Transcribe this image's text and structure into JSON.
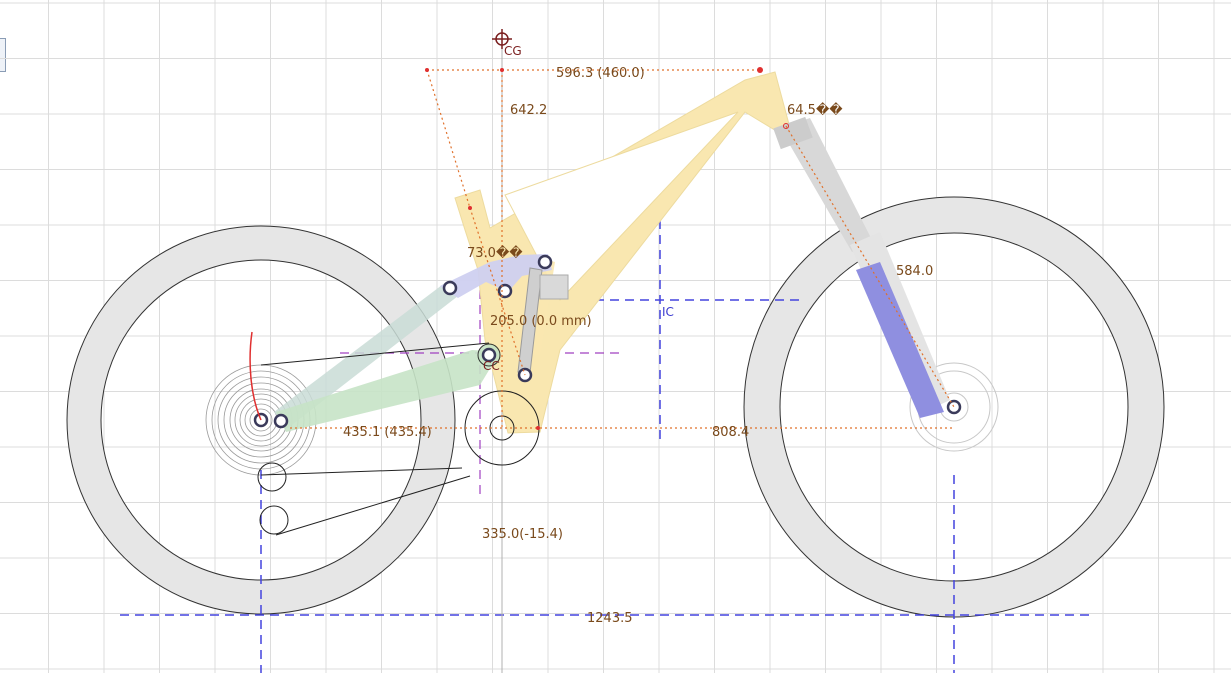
{
  "labels": {
    "cg": "CG",
    "ic": "IC",
    "cc": "CC"
  },
  "dimensions": {
    "top_length": "596.3 (460.0)",
    "stack": "642.2",
    "head_angle": "64.5��",
    "seat_angle": "73.0��",
    "fork_length": "584.0",
    "shock": "205.0 (0.0 mm)",
    "chainstay": "435.1 (435.4)",
    "front_center": "808.4",
    "bb_height": "335.0(-15.4)",
    "wheelbase": "1243.5"
  },
  "colors": {
    "frame": "#f9e7b0",
    "frame_stroke": "#e8d49a",
    "rocker": "#cfd0f0",
    "seatstay": "#c9dcd6",
    "chainstay": "#c6e3c6",
    "fork_lower": "#8f8fe0",
    "fork_upper": "#d6d6d6",
    "tire": "#e6e6e6",
    "grid": "#dcdcdc",
    "dim_line": "#e0702a",
    "construction": "#4444dd",
    "construction_purple": "#a040c0"
  }
}
